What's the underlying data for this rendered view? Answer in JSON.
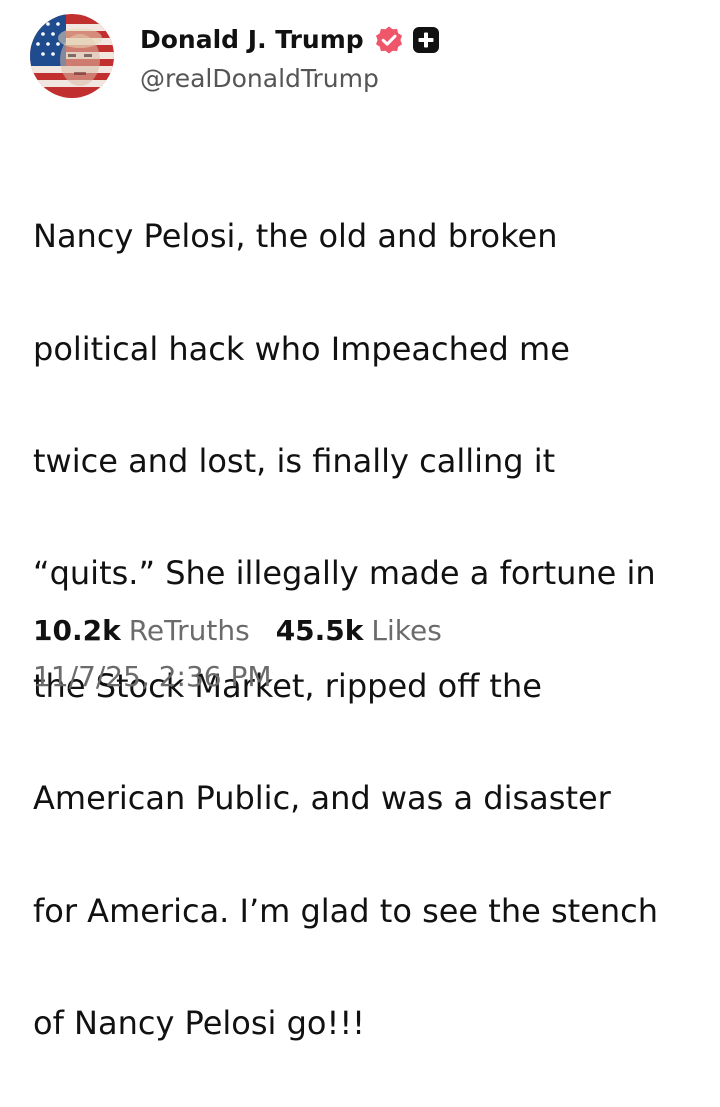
{
  "author": {
    "display_name": "Donald J. Trump",
    "handle": "@realDonaldTrump",
    "avatar_icon": "flag-portrait-avatar",
    "verified_icon": "verified-badge-icon",
    "plus_icon": "plus-badge-icon"
  },
  "post": {
    "text_lines": [
      "Nancy Pelosi, the old and broken",
      "political hack who Impeached me",
      "twice and lost, is finally calling it",
      "“quits.” She illegally made a fortune in",
      "the Stock Market, ripped off the",
      "American Public, and was a disaster",
      "for America. I’m glad to see the stench",
      "of Nancy Pelosi go!!!"
    ]
  },
  "stats": {
    "retruths_count": "10.2k",
    "retruths_label": "ReTruths",
    "likes_count": "45.5k",
    "likes_label": "Likes"
  },
  "timestamp": "11/7/25, 2:36 PM",
  "colors": {
    "verified": "#f0566a",
    "plus_badge": "#111111",
    "muted_text": "#6b6b6b"
  }
}
